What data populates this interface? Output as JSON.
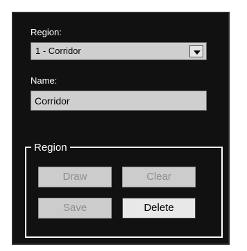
{
  "region_label": "Region:",
  "region_select": {
    "value": "1 - Corridor"
  },
  "name_label": "Name:",
  "name_field": {
    "value": "Corridor"
  },
  "region_group": {
    "title": "Region",
    "buttons": {
      "draw": "Draw",
      "clear": "Clear",
      "save": "Save",
      "delete": "Delete"
    }
  },
  "colors": {
    "panel_background": "#111111",
    "field_background": "#cfcfcf",
    "disabled_button": "#cccccc",
    "enabled_button": "#e8e8e8"
  },
  "icons": {
    "dropdown": "chevron-down-icon"
  }
}
